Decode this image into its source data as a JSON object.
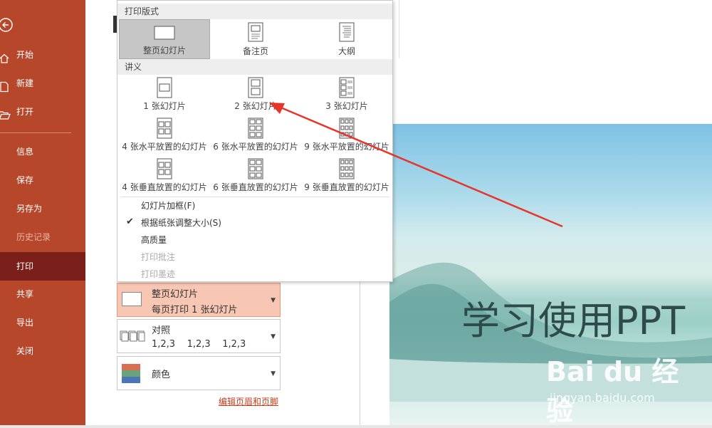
{
  "sidebar": {
    "items": [
      {
        "label": "开始"
      },
      {
        "label": "新建"
      },
      {
        "label": "打开"
      },
      {
        "label": "信息"
      },
      {
        "label": "保存"
      },
      {
        "label": "另存为"
      },
      {
        "label": "历史记录"
      },
      {
        "label": "打印"
      },
      {
        "label": "共享"
      },
      {
        "label": "导出"
      },
      {
        "label": "关闭"
      }
    ],
    "active": "打印",
    "colors": {
      "background": "#b7472a",
      "active": "#7a1f1a"
    }
  },
  "dropdown": {
    "print_layout": {
      "header": "打印版式",
      "options": [
        {
          "label": "整页幻灯片",
          "selected": true
        },
        {
          "label": "备注页"
        },
        {
          "label": "大纲"
        }
      ]
    },
    "handouts": {
      "header": "讲义",
      "options": [
        {
          "label": "1 张幻灯片"
        },
        {
          "label": "2 张幻灯片"
        },
        {
          "label": "3 张幻灯片"
        },
        {
          "label": "4 张水平放置的幻灯片"
        },
        {
          "label": "6 张水平放置的幻灯片"
        },
        {
          "label": "9 张水平放置的幻灯片"
        },
        {
          "label": "4 张垂直放置的幻灯片"
        },
        {
          "label": "6 张垂直放置的幻灯片"
        },
        {
          "label": "9 张垂直放置的幻灯片"
        }
      ]
    },
    "menu": [
      {
        "label": "幻灯片加框(F)",
        "checked": false,
        "enabled": true
      },
      {
        "label": "根据纸张调整大小(S)",
        "checked": true,
        "enabled": true
      },
      {
        "label": "高质量",
        "checked": false,
        "enabled": true
      },
      {
        "label": "打印批注",
        "checked": false,
        "enabled": false
      },
      {
        "label": "打印墨迹",
        "checked": false,
        "enabled": false
      }
    ]
  },
  "settings": {
    "layout": {
      "title": "整页幻灯片",
      "subtitle": "每页打印 1 张幻灯片"
    },
    "collate": {
      "title": "对照",
      "subtitle": "1,2,3    1,2,3    1,2,3"
    },
    "color": {
      "title": "颜色"
    },
    "edit_header_footer": "编辑页眉和页脚"
  },
  "preview": {
    "slide_title": "学习使用PPT",
    "watermark_main": "Bai du 经验",
    "watermark_sub": "jingyan.baidu.com"
  },
  "colors": {
    "accent": "#b7472a",
    "arrow": "#e8352a",
    "selected_setting": "#f8c7b3",
    "link": "#c43e1c"
  }
}
